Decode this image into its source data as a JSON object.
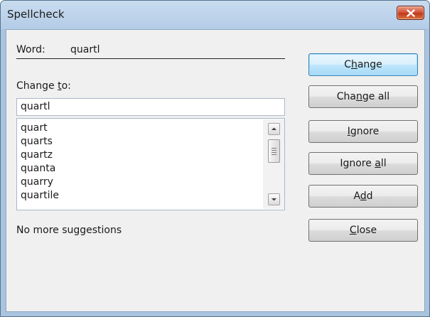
{
  "window": {
    "title": "Spellcheck"
  },
  "word": {
    "label": "Word:",
    "value": "quartl"
  },
  "change_to": {
    "label_before": "Change ",
    "label_mnemonic": "t",
    "label_after": "o:",
    "value": "quartl"
  },
  "suggestions": [
    "quart",
    "quarts",
    "quartz",
    "quanta",
    "quarry",
    "quartile"
  ],
  "status": "No more suggestions",
  "buttons": {
    "change": {
      "before": "C",
      "mnemonic": "h",
      "after": "ange"
    },
    "change_all": {
      "before": "Cha",
      "mnemonic": "n",
      "after": "ge all"
    },
    "ignore": {
      "before": "",
      "mnemonic": "I",
      "after": "gnore"
    },
    "ignore_all": {
      "before": "Ignore ",
      "mnemonic": "a",
      "after": "ll"
    },
    "add": {
      "before": "A",
      "mnemonic": "d",
      "after": "d"
    },
    "close": {
      "before": "",
      "mnemonic": "C",
      "after": "lose"
    }
  },
  "icons": {
    "close": "close-x-icon",
    "scroll_up": "scroll-up-arrow-icon",
    "scroll_down": "scroll-down-arrow-icon",
    "thumb_grip": "scroll-thumb-grip-icon"
  },
  "colors": {
    "title_bar": "#b9d1ea",
    "dialog_bg": "#f0f0f0",
    "close_button": "#c7432a",
    "default_button": "#3c7fb1"
  }
}
